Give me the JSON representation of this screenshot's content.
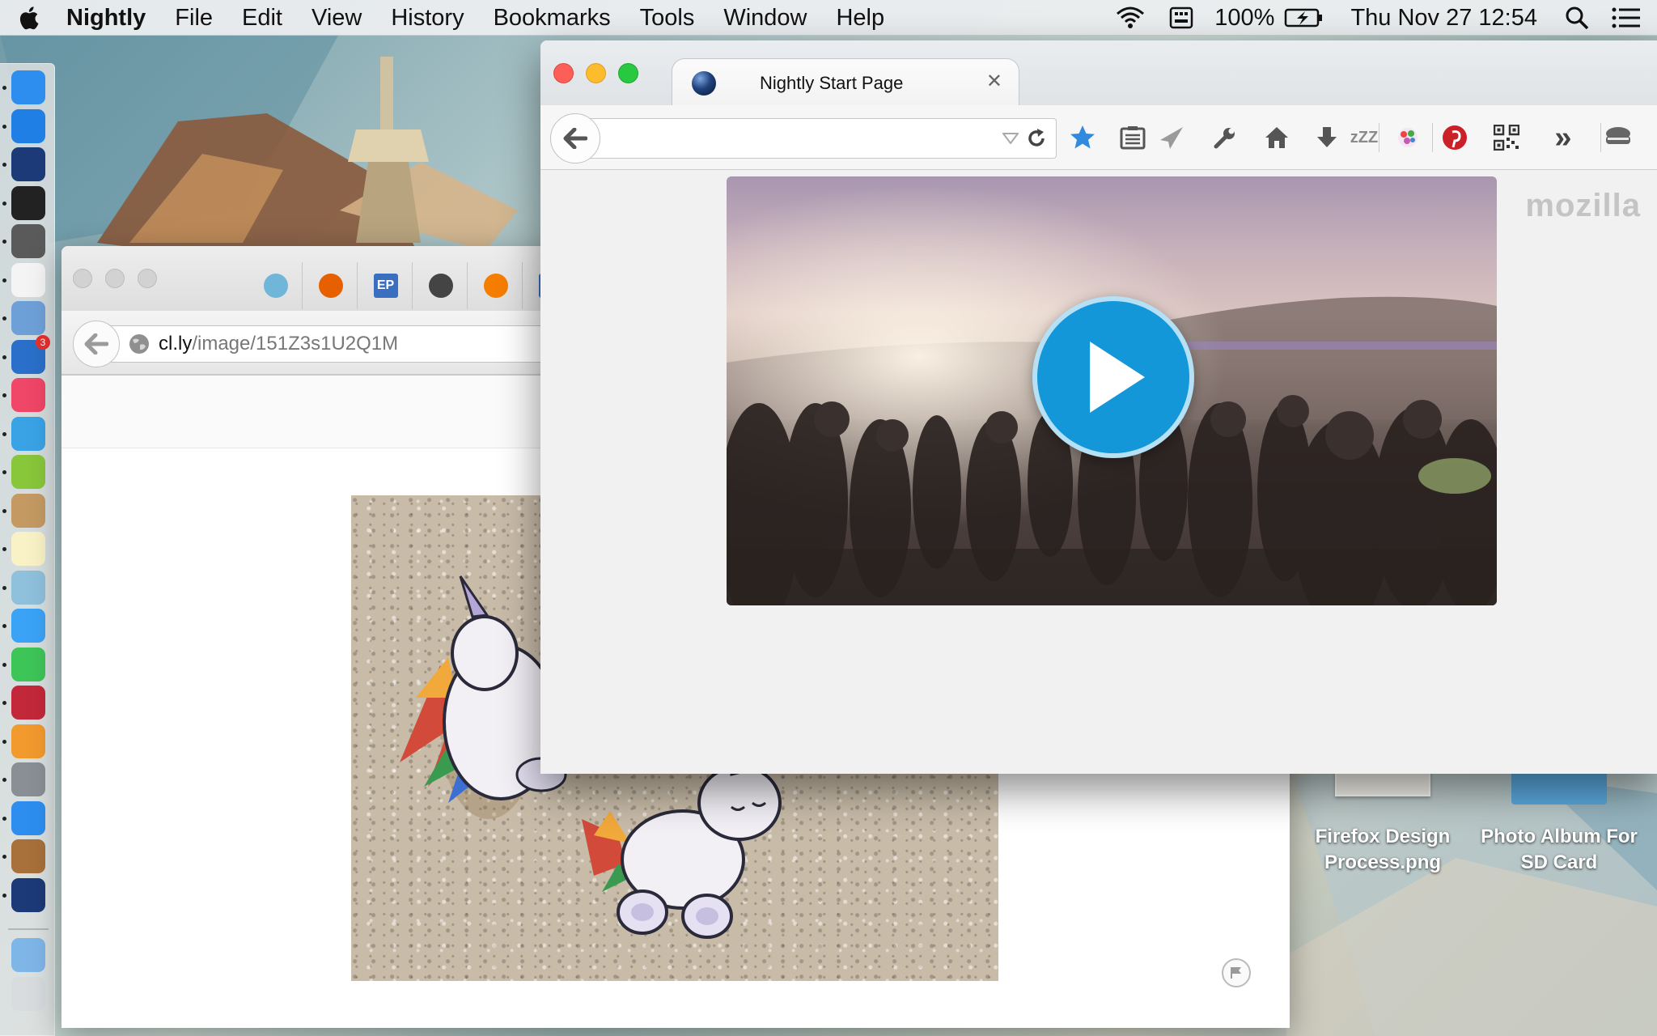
{
  "menubar": {
    "app_name": "Nightly",
    "items": [
      "File",
      "Edit",
      "View",
      "History",
      "Bookmarks",
      "Tools",
      "Window",
      "Help"
    ],
    "battery_percent": "100%",
    "clock": "Thu Nov 27  12:54"
  },
  "dock": {
    "apps": [
      {
        "icon": "finder-icon",
        "color": "#2d8ef0"
      },
      {
        "icon": "app-store-icon",
        "color": "#1f7fe4"
      },
      {
        "icon": "nightly-icon",
        "color": "#1c3a78"
      },
      {
        "icon": "terminal-icon",
        "color": "#222222"
      },
      {
        "icon": "sublime-text-icon",
        "color": "#5a5a5a"
      },
      {
        "icon": "calendar-icon",
        "color": "#f4f4f4"
      },
      {
        "icon": "preview-icon",
        "color": "#6ea0d8"
      },
      {
        "icon": "tasks-icon",
        "color": "#2a6fc9",
        "badge": "3"
      },
      {
        "icon": "itunes-icon",
        "color": "#f04668"
      },
      {
        "icon": "twitter-icon",
        "color": "#3aa3e6"
      },
      {
        "icon": "limechat-icon",
        "color": "#88c63a"
      },
      {
        "icon": "contacts-icon",
        "color": "#c49a62"
      },
      {
        "icon": "notes-icon",
        "color": "#f8f2c6"
      },
      {
        "icon": "photo-icon",
        "color": "#8fc0dc"
      },
      {
        "icon": "messages-icon",
        "color": "#3ba3f5"
      },
      {
        "icon": "facetime-icon",
        "color": "#3ec558"
      },
      {
        "icon": "photo-booth-icon",
        "color": "#c3283a"
      },
      {
        "icon": "ibooks-icon",
        "color": "#f29a2e"
      },
      {
        "icon": "system-preferences-icon",
        "color": "#8a8f96"
      },
      {
        "icon": "safari-icon",
        "color": "#2d8ef0"
      },
      {
        "icon": "acorn-icon",
        "color": "#a8703a"
      },
      {
        "icon": "nightly-icon",
        "color": "#1c3a78"
      }
    ],
    "stack_icons": [
      {
        "icon": "folder-icon",
        "color": "#7fb6e8"
      },
      {
        "icon": "trash-icon",
        "color": "#d8dcdf"
      }
    ]
  },
  "background_window": {
    "url_host": "cl.ly",
    "url_path": "/image/151Z3s1U2Q1M",
    "tabs": [
      {
        "icon": "ingress-icon",
        "text": "",
        "color": "#6fb6d8"
      },
      {
        "icon": "firefox-icon",
        "text": "",
        "color": "#e66000"
      },
      {
        "icon": "ep-icon",
        "text": "EP",
        "color": "#3a6fc0"
      },
      {
        "icon": "tv-icon",
        "text": "",
        "color": "#444444"
      },
      {
        "icon": "blogger-icon",
        "text": "",
        "color": "#f57d00"
      },
      {
        "icon": "ep-icon",
        "text": "EP",
        "color": "#3a6fc0"
      }
    ]
  },
  "front_window": {
    "tab_title": "Nightly Start Page",
    "tab_close": "✕",
    "url_value": "",
    "toolbar_icons": [
      {
        "icon": "bookmark-star-icon",
        "color": "#2f8ae0"
      },
      {
        "icon": "bookmarks-list-icon",
        "color": "#555555"
      },
      {
        "icon": "send-icon",
        "color": "#9a9a9a"
      },
      {
        "icon": "wrench-icon",
        "color": "#555555"
      },
      {
        "icon": "home-icon",
        "color": "#555555"
      },
      {
        "icon": "download-icon",
        "color": "#555555"
      },
      {
        "icon": "sleep-tabs-icon",
        "color": "#8a8a8a",
        "text": "zZZ"
      },
      {
        "icon": "colorful-extension-icon",
        "color": "#c65ab5"
      },
      {
        "icon": "pinterest-icon",
        "color": "#cb2027"
      },
      {
        "icon": "qr-code-icon",
        "color": "#333333"
      },
      {
        "icon": "overflow-chevrons-icon",
        "color": "#444444",
        "text": "»"
      },
      {
        "icon": "menu-icon",
        "color": "#666666"
      }
    ],
    "brand_word": "mozilla",
    "play_color": "#1497d8"
  },
  "desktop": {
    "icons": [
      {
        "label": "Firefox Design Process.png",
        "icon": "image-file-icon"
      },
      {
        "label": "Photo Album For SD Card",
        "icon": "folder-icon"
      }
    ]
  }
}
